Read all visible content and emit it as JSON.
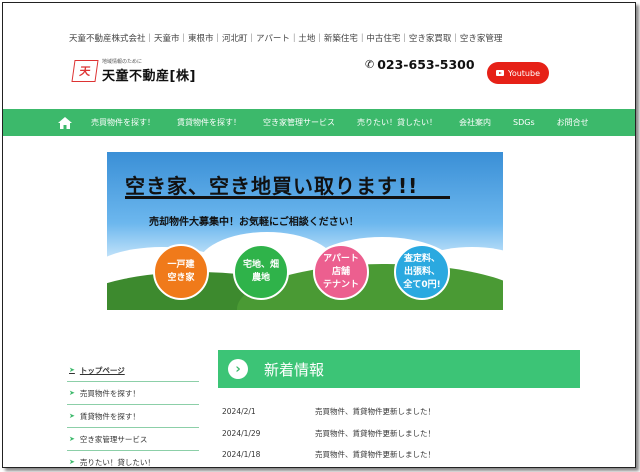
{
  "header": {
    "top_links": "天童不動産株式会社｜天童市｜東根市｜河北町｜アパート｜土地｜新築住宅｜中古住宅｜空き家買取｜空き家管理",
    "logo_mark": "天",
    "logo_sub": "地域情報のために",
    "logo_name": "天童不動産[株]",
    "phone": "023-653-5300",
    "youtube_label": "Youtube"
  },
  "nav": {
    "items": [
      "売買物件を探す！",
      "賃貸物件を探す！",
      "空き家管理サービス",
      "売りたい！貸したい！",
      "会社案内",
      "SDGs",
      "お問合せ"
    ]
  },
  "banner": {
    "title": "空き家、空き地買い取ります!!",
    "subtitle": "売却物件大募集中！お気軽にご相談ください！",
    "circles": [
      {
        "label": "一戸建\n空き家",
        "color": "#f07a1a"
      },
      {
        "label": "宅地、畑\n農地",
        "color": "#2fb34a"
      },
      {
        "label": "アパート\n店舗\nテナント",
        "color": "#ec5f8f"
      },
      {
        "label": "査定料、\n出張料、\n全て0円!",
        "color": "#2aa9e0"
      }
    ]
  },
  "sidebar": {
    "items": [
      "トップページ",
      "売買物件を探す！",
      "賃貸物件を探す！",
      "空き家管理サービス",
      "売りたい！貸したい！"
    ]
  },
  "news": {
    "title": "新着情報",
    "items": [
      {
        "date": "2024/2/1",
        "text": "売買物件、賃貸物件更新しました！"
      },
      {
        "date": "2024/1/29",
        "text": "売買物件、賃貸物件更新しました！"
      },
      {
        "date": "2024/1/18",
        "text": "売買物件、賃貸物件更新しました！"
      }
    ]
  },
  "colors": {
    "accent": "#3cb96b",
    "youtube": "#e62117"
  }
}
